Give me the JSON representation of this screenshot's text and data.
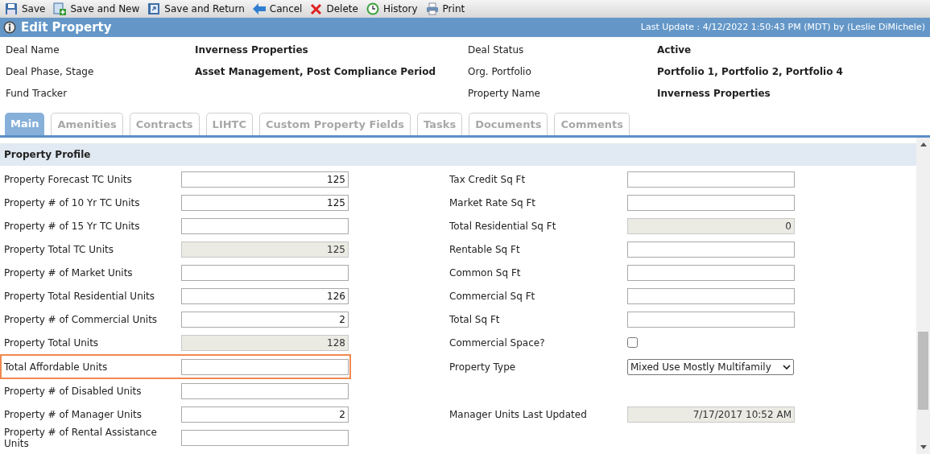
{
  "toolbar": [
    {
      "label": "Save",
      "kind": "save"
    },
    {
      "label": "Save and New",
      "kind": "new"
    },
    {
      "label": "Save and Return",
      "kind": "return"
    },
    {
      "label": "Cancel",
      "kind": "cancel"
    },
    {
      "label": "Delete",
      "kind": "delete"
    },
    {
      "label": "History",
      "kind": "history"
    },
    {
      "label": "Print",
      "kind": "print"
    }
  ],
  "header": {
    "title": "Edit Property",
    "last_update": "Last Update : 4/12/2022 1:50:43 PM (MDT) by (Leslie DiMichele)"
  },
  "deal_info": [
    {
      "label": "Deal Name",
      "value": "Inverness Properties"
    },
    {
      "label": "Deal Status",
      "value": "Active"
    },
    {
      "label": "Deal Phase, Stage",
      "value": "Asset Management, Post Compliance Period"
    },
    {
      "label": "Org. Portfolio",
      "value": "Portfolio 1, Portfolio 2, Portfolio 4"
    },
    {
      "label": "Fund Tracker"
    },
    {
      "label": "Property Name",
      "value": "Inverness Properties"
    }
  ],
  "tabs": [
    {
      "label": "Main",
      "selected": true
    },
    {
      "label": "Amenities",
      "selected": false
    },
    {
      "label": "Contracts",
      "selected": false
    },
    {
      "label": "LIHTC",
      "selected": false
    },
    {
      "label": "Custom Property Fields",
      "selected": false
    },
    {
      "label": "Tasks",
      "selected": false
    },
    {
      "label": "Documents",
      "selected": false
    },
    {
      "label": "Comments",
      "selected": false
    }
  ],
  "section": {
    "title": "Property Profile"
  },
  "rows": [
    {
      "left": {
        "label": "Property Forecast TC Units",
        "kind": "text",
        "value": "125",
        "disabled": false,
        "highlighted": false
      },
      "right": {
        "label": "Tax Credit Sq Ft",
        "kind": "text",
        "disabled": false
      }
    },
    {
      "left": {
        "label": "Property # of 10 Yr TC Units",
        "kind": "text",
        "value": "125",
        "disabled": false,
        "highlighted": false
      },
      "right": {
        "label": "Market Rate Sq Ft",
        "kind": "text",
        "disabled": false
      }
    },
    {
      "left": {
        "label": "Property # of 15 Yr TC Units",
        "kind": "text",
        "disabled": false,
        "highlighted": false
      },
      "right": {
        "label": "Total Residential Sq Ft",
        "kind": "text",
        "value": "0",
        "disabled": true
      }
    },
    {
      "left": {
        "label": "Property Total TC Units",
        "kind": "text",
        "value": "125",
        "disabled": true,
        "highlighted": false
      },
      "right": {
        "label": "Rentable Sq Ft",
        "kind": "text",
        "disabled": false
      }
    },
    {
      "left": {
        "label": "Property # of Market Units",
        "kind": "text",
        "disabled": false,
        "highlighted": false
      },
      "right": {
        "label": "Common Sq Ft",
        "kind": "text",
        "disabled": false
      }
    },
    {
      "left": {
        "label": "Property Total Residential Units",
        "kind": "text",
        "value": "126",
        "disabled": false,
        "highlighted": false
      },
      "right": {
        "label": "Commercial Sq Ft",
        "kind": "text",
        "disabled": false
      }
    },
    {
      "left": {
        "label": "Property # of Commercial Units",
        "kind": "text",
        "value": "2",
        "disabled": false,
        "highlighted": false
      },
      "right": {
        "label": "Total Sq Ft",
        "kind": "text",
        "disabled": false
      }
    },
    {
      "left": {
        "label": "Property Total Units",
        "kind": "text",
        "value": "128",
        "disabled": true,
        "highlighted": false
      },
      "right": {
        "label": "Commercial Space?",
        "kind": "checkbox",
        "checked": false
      }
    },
    {
      "left": {
        "label": "Total Affordable Units",
        "kind": "text",
        "disabled": false,
        "highlighted": true
      },
      "right": {
        "label": "Property Type",
        "kind": "select",
        "value": "Mixed Use Mostly Multifamily"
      }
    },
    {
      "left": {
        "label": "Property # of Disabled Units",
        "kind": "text",
        "disabled": false,
        "highlighted": false
      }
    },
    {
      "left": {
        "label": "Property # of Manager Units",
        "kind": "text",
        "value": "2",
        "disabled": false,
        "highlighted": false
      },
      "right": {
        "label": "Manager Units Last Updated",
        "kind": "text",
        "value": "7/17/2017 10:52 AM",
        "disabled": true
      }
    },
    {
      "left": {
        "label": "Property # of Rental Assistance Units",
        "kind": "text",
        "disabled": false,
        "highlighted": false
      }
    }
  ]
}
